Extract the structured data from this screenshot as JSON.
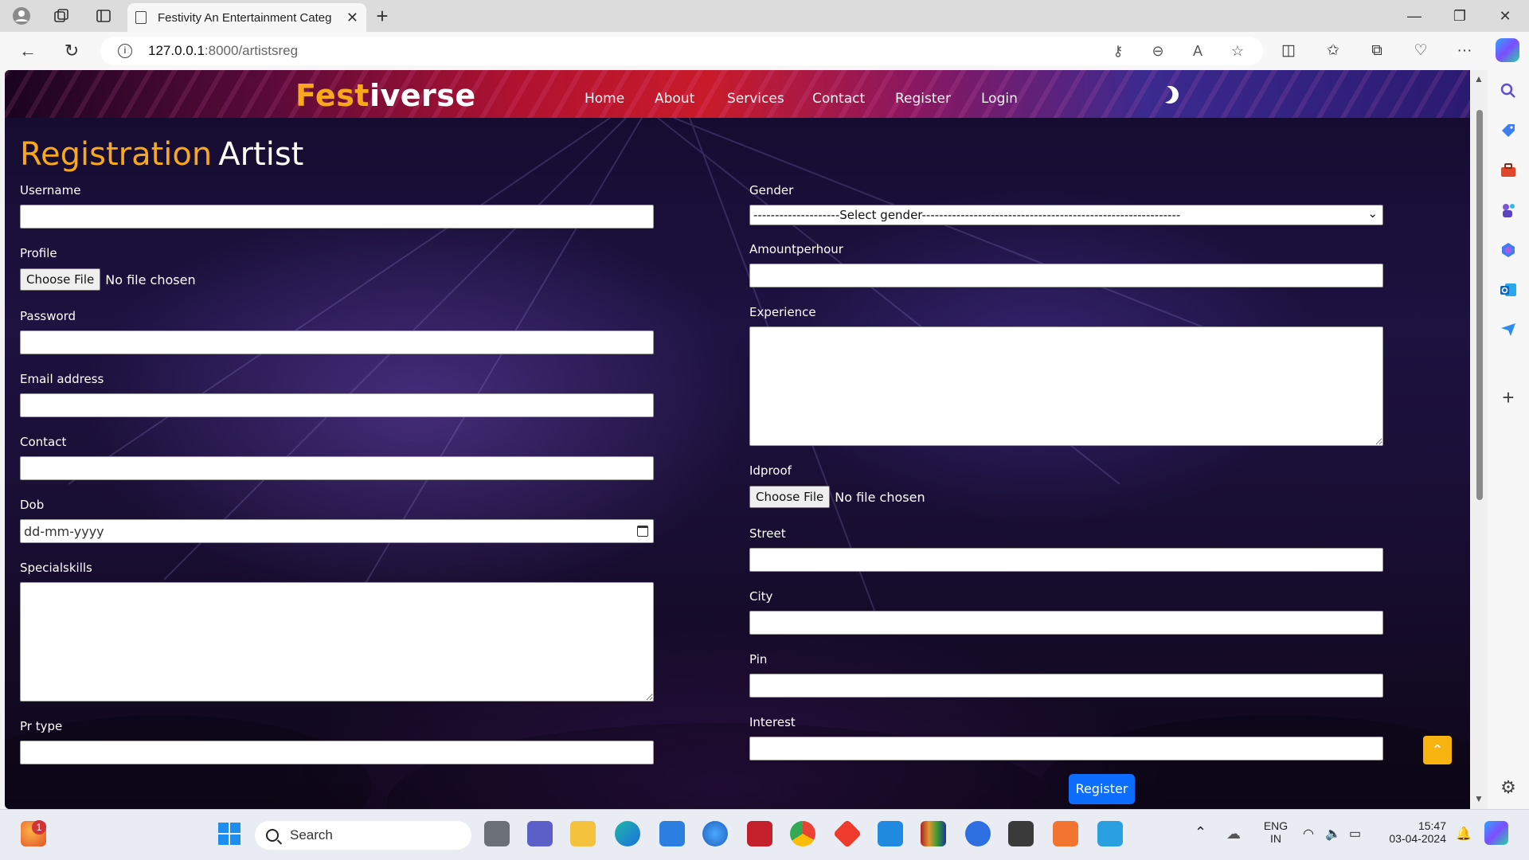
{
  "browser": {
    "tab_title": "Festivity An Entertainment Categ",
    "url_host": "127.0.0.1",
    "url_rest": ":8000/artistsreg"
  },
  "site": {
    "logo_part1": "Fest",
    "logo_part2": "iverse",
    "nav": [
      "Home",
      "About",
      "Services",
      "Contact",
      "Register",
      "Login"
    ]
  },
  "form": {
    "title_part1": "Registration",
    "title_part2": "Artist",
    "left": {
      "username_label": "Username",
      "profile_label": "Profile",
      "password_label": "Password",
      "email_label": "Email address",
      "contact_label": "Contact",
      "dob_label": "Dob",
      "dob_placeholder": "dd-mm-yyyy",
      "specialskills_label": "Specialskills",
      "prtype_label": "Pr type"
    },
    "right": {
      "gender_label": "Gender",
      "gender_selected": "--------------------Select gender------------------------------------------------------------",
      "amount_label": "Amountperhour",
      "experience_label": "Experience",
      "idproof_label": "Idproof",
      "street_label": "Street",
      "city_label": "City",
      "pin_label": "Pin",
      "interest_label": "Interest"
    },
    "file_button": "Choose File",
    "file_status": "No file chosen",
    "submit_label": "Register"
  },
  "taskbar": {
    "search_placeholder": "Search",
    "lang_line1": "ENG",
    "lang_line2": "IN",
    "time": "15:47",
    "date": "03-04-2024",
    "notification_count": "1"
  },
  "colors": {
    "accent_orange": "#f7a81b",
    "button_blue": "#0d6efd",
    "back_to_top": "#f7b30f"
  }
}
